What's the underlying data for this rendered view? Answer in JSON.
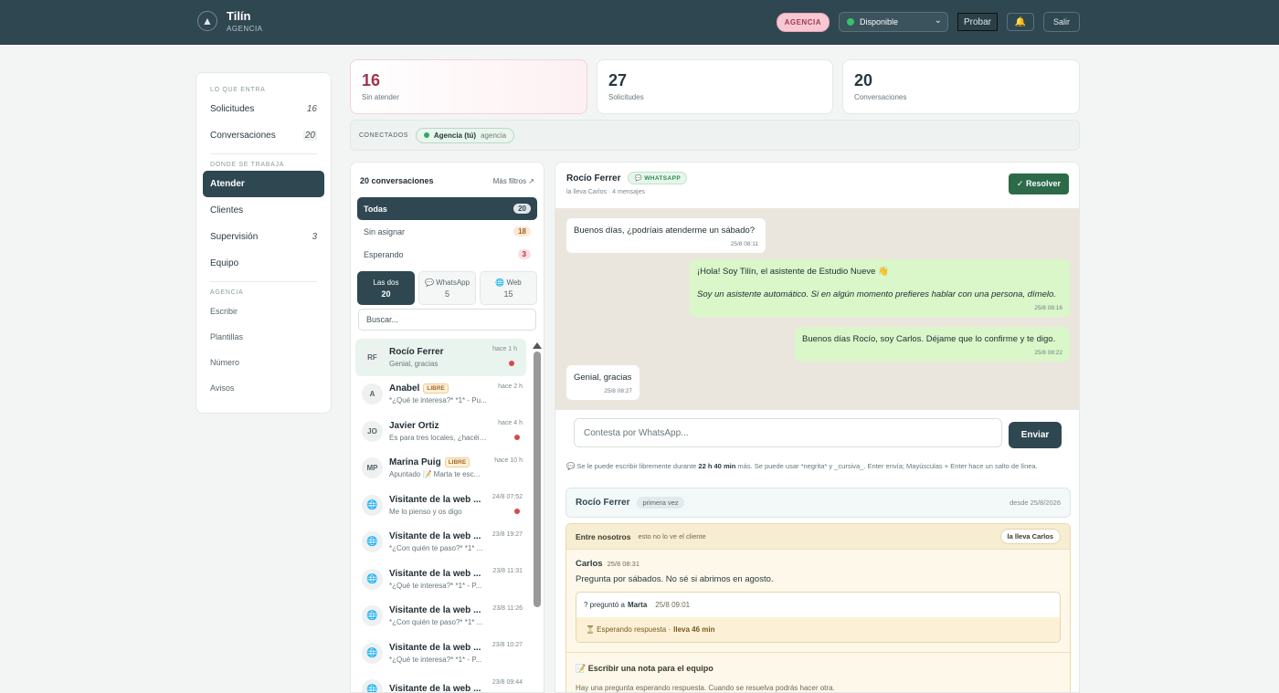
{
  "header": {
    "brand_name": "Tilín",
    "brand_sub": "AGENCIA",
    "role_badge": "AGENCIA",
    "status": "Disponible",
    "probar": "Probar",
    "salir": "Salir"
  },
  "sidebar": {
    "section1": "LO QUE ENTRA",
    "solicitudes": {
      "label": "Solicitudes",
      "count": "16"
    },
    "conversaciones": {
      "label": "Conversaciones",
      "count": "20"
    },
    "section2": "DONDE SE TRABAJA",
    "atender": "Atender",
    "clientes": "Clientes",
    "supervision": {
      "label": "Supervisión",
      "count": "3"
    },
    "equipo": "Equipo",
    "section3": "AGENCIA",
    "escribir": "Escribir",
    "plantillas": "Plantillas",
    "numero": "Número",
    "avisos": "Avisos"
  },
  "stats": [
    {
      "num": "16",
      "label": "Sin atender"
    },
    {
      "num": "27",
      "label": "Solicitudes"
    },
    {
      "num": "20",
      "label": "Conversaciones"
    }
  ],
  "connected": {
    "label": "CONECTADOS",
    "agent_name": "Agencia (tú)",
    "agent_role": "agencia"
  },
  "convlist": {
    "title": "20 conversaciones",
    "more_filters": "Más filtros ↗",
    "filters": [
      {
        "label": "Todas",
        "count": "20"
      },
      {
        "label": "Sin asignar",
        "count": "18"
      },
      {
        "label": "Esperando",
        "count": "3"
      }
    ],
    "channels": [
      {
        "label": "Las dos",
        "count": "20"
      },
      {
        "label": "WhatsApp",
        "count": "5"
      },
      {
        "label": "Web",
        "count": "15"
      }
    ],
    "search_placeholder": "Buscar...",
    "items": [
      {
        "initials": "RF",
        "name": "Rocío Ferrer",
        "preview": "Genial, gracias",
        "time": "hace 1 h",
        "libre": ""
      },
      {
        "initials": "A",
        "name": "Anabel",
        "preview": "*¿Qué te interesa?* *1* - Pu...",
        "time": "hace 2 h",
        "libre": "LIBRE"
      },
      {
        "initials": "JO",
        "name": "Javier Ortiz",
        "preview": "Es para tres locales, ¿hacéis ...",
        "time": "hace 4 h",
        "libre": ""
      },
      {
        "initials": "MP",
        "name": "Marina Puig",
        "preview": "Apuntado 📝 Marta te esc...",
        "time": "hace 10 h",
        "libre": "LIBRE"
      },
      {
        "initials": "🌐",
        "name": "Visitante de la web ...",
        "preview": "Me lo pienso y os digo",
        "time": "24/8 07:52",
        "libre": ""
      },
      {
        "initials": "🌐",
        "name": "Visitante de la web ...",
        "preview": "*¿Con quién te paso?* *1* ...",
        "time": "23/8 19:27",
        "libre": ""
      },
      {
        "initials": "🌐",
        "name": "Visitante de la web ...",
        "preview": "*¿Qué te interesa?* *1* - P...",
        "time": "23/8 11:31",
        "libre": ""
      },
      {
        "initials": "🌐",
        "name": "Visitante de la web ...",
        "preview": "*¿Con quién te paso?* *1* ...",
        "time": "23/8 11:26",
        "libre": ""
      },
      {
        "initials": "🌐",
        "name": "Visitante de la web ...",
        "preview": "*¿Qué te interesa?* *1* - P...",
        "time": "23/8 10:27",
        "libre": ""
      },
      {
        "initials": "🌐",
        "name": "Visitante de la web ...",
        "preview": "",
        "time": "23/8 09:44",
        "libre": ""
      }
    ]
  },
  "chat": {
    "name": "Rocío Ferrer",
    "channel": "WHATSAPP",
    "sub": "la lleva Carlos · 4 mensajes",
    "resolver": "✓ Resolver",
    "messages": [
      {
        "text": "Buenos días, ¿podríais atenderme un sábado?",
        "time": "25/8 08:11"
      },
      {
        "text": "¡Hola! Soy Tilín, el asistente de Estudio Nueve 👋",
        "italic": "Soy un asistente automático. Si en algún momento prefieres hablar con una persona, dímelo.",
        "time": "25/8 08:16"
      },
      {
        "text": "Buenos días Rocío, soy Carlos. Déjame que lo confirme y te digo.",
        "time": "25/8 08:22"
      },
      {
        "text": "Genial, gracias",
        "time": "25/8 08:27"
      }
    ],
    "composer_placeholder": "Contesta por WhatsApp...",
    "send": "Enviar",
    "hint_pre": "💬 Se le puede escribir libremente durante ",
    "hint_time": "22 h 40 min",
    "hint_post": " más. Se puede usar *negrita* y _cursiva_. Enter envía; Mayúsculas + Enter hace un salto de línea."
  },
  "client": {
    "name": "Rocío Ferrer",
    "visit": "primera vez",
    "since": "desde 25/8/2026"
  },
  "notes": {
    "title": "Entre nosotros",
    "subtitle": "esto no lo ve el cliente",
    "owner": "la lleva Carlos",
    "note_author": "Carlos",
    "note_time": "25/8 08:31",
    "note_text": "Pregunta por sábados. No sé si abrimos en agosto.",
    "q_pre": "? preguntó a",
    "q_to": "Marta",
    "q_time": "25/8 09:01",
    "q_status": "⏳ Esperando respuesta ·",
    "q_wait": "lleva 46 min",
    "write": "📝 Escribir una nota para el equipo",
    "write_hint": "Hay una pregunta esperando respuesta. Cuando se resuelva podrás hacer otra."
  }
}
